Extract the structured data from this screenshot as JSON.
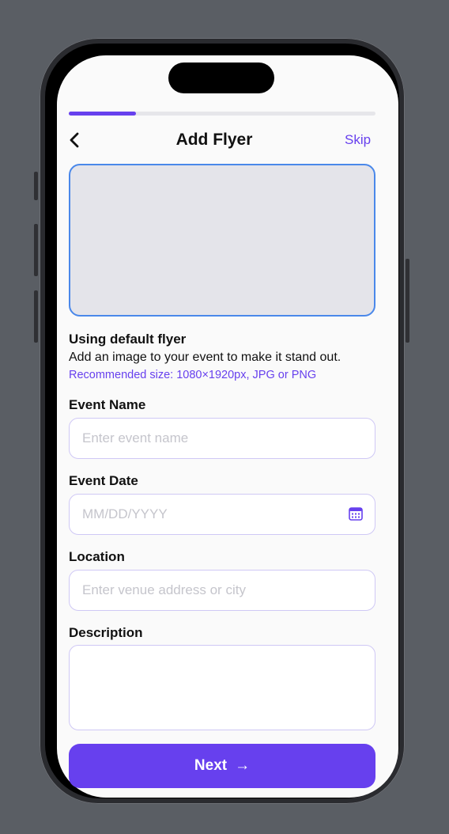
{
  "header": {
    "title": "Add Flyer",
    "skip_label": "Skip",
    "progress": 0.22
  },
  "flyer": {
    "title": "Using default flyer",
    "description": "Add an image to your event to make it stand out.",
    "recommendation": "Recommended size: 1080×1920px, JPG or PNG"
  },
  "form": {
    "event_name": {
      "label": "Event Name",
      "placeholder": "Enter event name",
      "value": ""
    },
    "event_date": {
      "label": "Event Date",
      "placeholder": "MM/DD/YYYY",
      "value": ""
    },
    "location": {
      "label": "Location",
      "placeholder": "Enter venue address or city",
      "value": ""
    },
    "description": {
      "label": "Description",
      "placeholder": "",
      "value": ""
    }
  },
  "footer": {
    "next_label": "Next",
    "next_arrow": "→"
  },
  "colors": {
    "accent": "#6740ee",
    "focus_border": "#4a88ea",
    "flyer_bg": "#e4e4ea",
    "input_border": "#cfc8f5"
  },
  "icons": {
    "back": "chevron-left-icon",
    "calendar": "calendar-icon",
    "next": "arrow-right-icon"
  }
}
